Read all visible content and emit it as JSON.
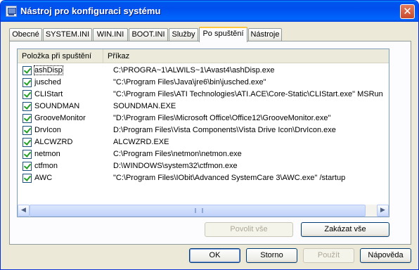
{
  "window": {
    "title": "Nástroj pro konfiguraci systému",
    "close_glyph": "✕"
  },
  "tabs": [
    {
      "label": "Obecné"
    },
    {
      "label": "SYSTEM.INI"
    },
    {
      "label": "WIN.INI"
    },
    {
      "label": "BOOT.INI"
    },
    {
      "label": "Služby"
    },
    {
      "label": "Po spuštění",
      "active": true
    },
    {
      "label": "Nástroje"
    }
  ],
  "startup_list": {
    "columns": [
      "Položka při spuštění",
      "Příkaz"
    ],
    "rows": [
      {
        "name": "ashDisp",
        "command": "C:\\PROGRA~1\\ALWILS~1\\Avast4\\ashDisp.exe",
        "checked": true
      },
      {
        "name": "jusched",
        "command": "\"C:\\Program Files\\Java\\jre6\\bin\\jusched.exe\"",
        "checked": true
      },
      {
        "name": "CLIStart",
        "command": "\"C:\\Program Files\\ATI Technologies\\ATI.ACE\\Core-Static\\CLIStart.exe\" MSRun",
        "checked": true
      },
      {
        "name": "SOUNDMAN",
        "command": "SOUNDMAN.EXE",
        "checked": true
      },
      {
        "name": "GrooveMonitor",
        "command": "\"D:\\Program Files\\Microsoft Office\\Office12\\GrooveMonitor.exe\"",
        "checked": true
      },
      {
        "name": "DrvIcon",
        "command": "D:\\Program Files\\Vista Components\\Vista Drive Icon\\DrvIcon.exe",
        "checked": true
      },
      {
        "name": "ALCWZRD",
        "command": "ALCWZRD.EXE",
        "checked": true
      },
      {
        "name": "netmon",
        "command": "C:\\Program Files\\netmon\\netmon.exe",
        "checked": true
      },
      {
        "name": "ctfmon",
        "command": "D:\\WINDOWS\\system32\\ctfmon.exe",
        "checked": true
      },
      {
        "name": "AWC",
        "command": "\"C:\\Program Files\\IObit\\Advanced SystemCare 3\\AWC.exe\" /startup",
        "checked": true
      }
    ]
  },
  "scrollbar": {
    "left_glyph": "◀",
    "right_glyph": "▶"
  },
  "panel_buttons": {
    "enable_all": "Povolit vše",
    "disable_all": "Zakázat vše"
  },
  "dialog_buttons": {
    "ok": "OK",
    "cancel": "Storno",
    "apply": "Použít",
    "help": "Nápověda"
  }
}
